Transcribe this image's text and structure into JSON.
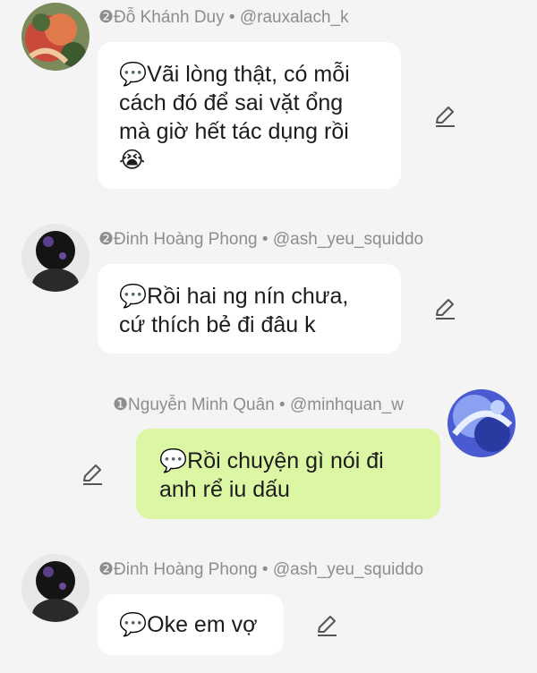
{
  "messages": [
    {
      "rank": "❷",
      "name": "Đỗ Khánh Duy",
      "sep": "•",
      "handle": "@rauxalach_k",
      "lines": [
        "Vãi lòng thật, có mỗi",
        "cách đó để sai vặt ổng",
        "mà giờ hết tác dụng rồi"
      ],
      "emoji": "😭",
      "bubble_icon": "💬"
    },
    {
      "rank": "❷",
      "name": "Đinh Hoàng Phong",
      "sep": "•",
      "handle": "@ash_yeu_squiddo",
      "lines": [
        "Rồi hai ng nín chưa,",
        "cứ thích bẻ đi đâu k"
      ],
      "bubble_icon": "💬"
    },
    {
      "rank": "❶",
      "name": "Nguyễn Minh Quân",
      "sep": "•",
      "handle": "@minhquan_w",
      "lines": [
        "Rồi chuyện gì nói đi",
        "anh rể iu dấu"
      ],
      "bubble_icon": "💬"
    },
    {
      "rank": "❷",
      "name": "Đinh Hoàng Phong",
      "sep": "•",
      "handle": "@ash_yeu_squiddo",
      "lines": [
        "Oke em vợ"
      ],
      "bubble_icon": "💬"
    }
  ],
  "icons": {
    "edit": "pencil-icon",
    "speech": "speech-bubble-icon"
  },
  "colors": {
    "background": "#f4f4f4",
    "incoming_bubble": "#ffffff",
    "outgoing_bubble": "#dcf7a4",
    "meta_text": "#8d8d8d",
    "message_text": "#1c1c1c"
  }
}
